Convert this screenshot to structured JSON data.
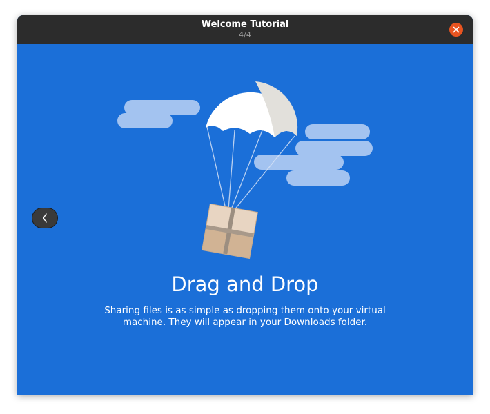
{
  "window": {
    "title": "Welcome Tutorial",
    "page_indicator": "4/4"
  },
  "slide": {
    "heading": "Drag and Drop",
    "description": "Sharing files is as simple as dropping them onto your virtual machine. They will appear in your Downloads folder.",
    "illustration": "parachute-package-illustration"
  },
  "controls": {
    "back_icon": "chevron-left-icon",
    "close_icon": "close-icon"
  },
  "colors": {
    "background": "#1b6fd8",
    "titlebar": "#2c2c2c",
    "close_button": "#e95420",
    "cloud": "#a3c3f0",
    "parachute": "#ffffff",
    "box": "#e4d0b9"
  }
}
